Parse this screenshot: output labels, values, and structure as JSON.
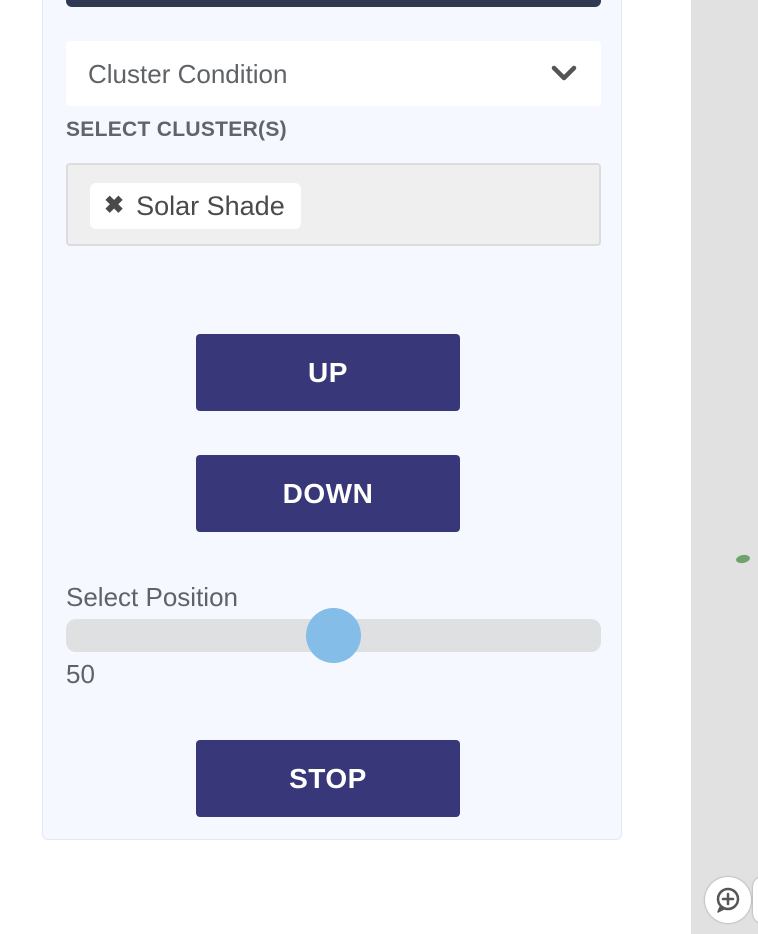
{
  "cluster_condition": {
    "selected_value": "Cluster Condition",
    "chevron_icon": "chevron-down-icon"
  },
  "cluster_select": {
    "label": "SELECT CLUSTER(S)",
    "chips": [
      {
        "label": "Solar Shade",
        "remove_icon": "close-icon"
      }
    ]
  },
  "actions": {
    "up_label": "UP",
    "down_label": "DOWN",
    "stop_label": "STOP"
  },
  "position": {
    "label": "Select Position",
    "value": "50",
    "min": 0,
    "max": 100
  },
  "colors": {
    "button": "#373779",
    "slider_thumb": "#83bde8",
    "panel_bg": "#f5f8fe"
  },
  "map": {
    "control_icon": "map-comment-icon"
  }
}
